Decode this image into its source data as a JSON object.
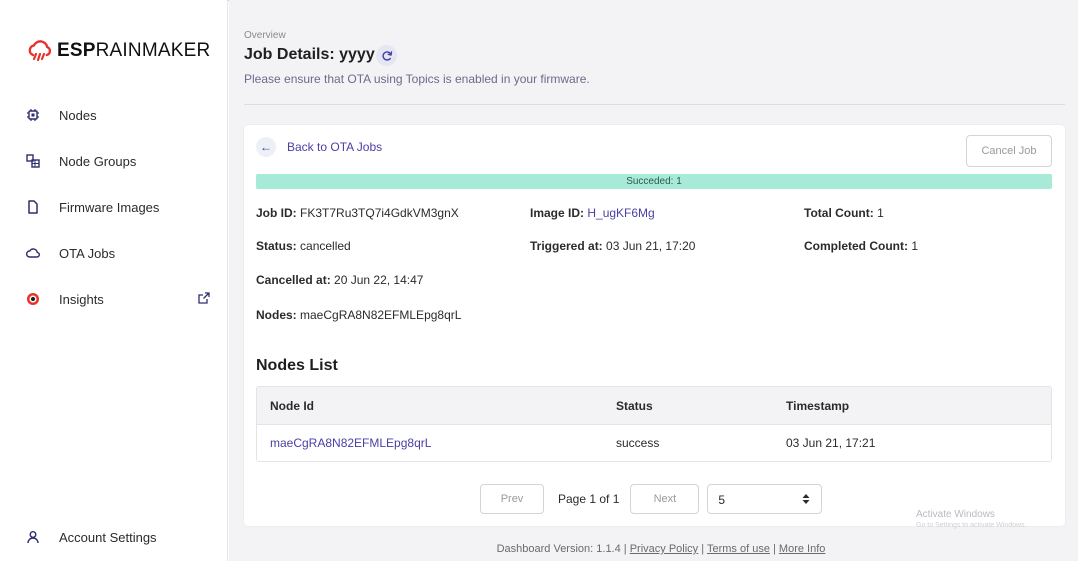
{
  "brand": {
    "bold": "ESP",
    "rest": "RAINMAKER"
  },
  "sidebar": {
    "items": [
      {
        "label": "Nodes",
        "icon": "chip-icon"
      },
      {
        "label": "Node Groups",
        "icon": "node-groups-icon"
      },
      {
        "label": "Firmware Images",
        "icon": "file-icon"
      },
      {
        "label": "OTA Jobs",
        "icon": "cloud-icon"
      },
      {
        "label": "Insights",
        "icon": "insights-icon",
        "external": true
      }
    ],
    "account": {
      "label": "Account Settings",
      "icon": "user-icon"
    }
  },
  "header": {
    "breadcrumb": "Overview",
    "title": "Job Details: yyyy",
    "subtitle": "Please ensure that OTA using Topics is enabled in your firmware."
  },
  "job": {
    "back_label": "Back to OTA Jobs",
    "cancel_label": "Cancel Job",
    "progress_label": "Succeded: 1",
    "progress_fraction": 1.0,
    "job_id_key": "Job ID:",
    "job_id": "FK3T7Ru3TQ7i4GdkVM3gnX",
    "status_key": "Status:",
    "status": "cancelled",
    "cancelled_at_key": "Cancelled at:",
    "cancelled_at": "20 Jun 22, 14:47",
    "nodes_key": "Nodes:",
    "nodes": "maeCgRA8N82EFMLEpg8qrL",
    "image_id_key": "Image ID:",
    "image_id": "H_ugKF6Mg",
    "triggered_at_key": "Triggered at:",
    "triggered_at": "03 Jun 21, 17:20",
    "total_count_key": "Total Count:",
    "total_count": "1",
    "completed_count_key": "Completed Count:",
    "completed_count": "1"
  },
  "nodes_list": {
    "heading": "Nodes List",
    "columns": [
      "Node Id",
      "Status",
      "Timestamp"
    ],
    "rows": [
      [
        "maeCgRA8N82EFMLEpg8qrL",
        "success",
        "03 Jun 21, 17:21"
      ]
    ]
  },
  "pagination": {
    "prev": "Prev",
    "info": "Page 1 of 1",
    "next": "Next",
    "page_size": "5"
  },
  "footer": {
    "version": "Dashboard Version: 1.1.4",
    "links": [
      "Privacy Policy",
      "Terms of use",
      "More Info"
    ]
  },
  "watermark": {
    "line1": "Activate Windows",
    "line2": "Go to Settings to activate Windows."
  },
  "colors": {
    "accent": "#4a3fa6",
    "progress": "#a6ead7",
    "logo_red": "#e8322c"
  }
}
